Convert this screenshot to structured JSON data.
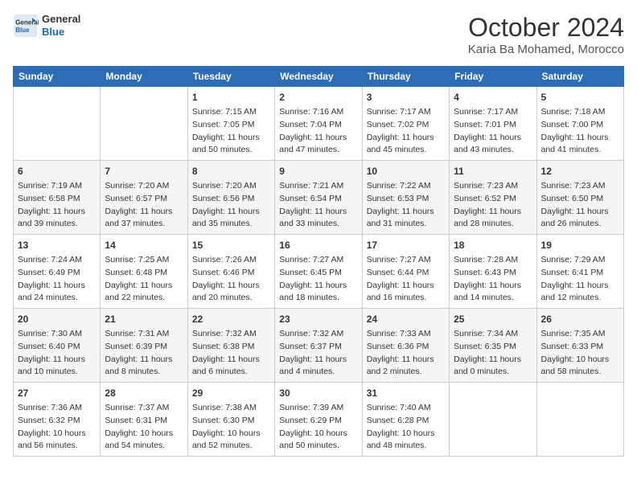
{
  "header": {
    "logo_general": "General",
    "logo_blue": "Blue",
    "month": "October 2024",
    "location": "Karia Ba Mohamed, Morocco"
  },
  "days_of_week": [
    "Sunday",
    "Monday",
    "Tuesday",
    "Wednesday",
    "Thursday",
    "Friday",
    "Saturday"
  ],
  "weeks": [
    [
      {
        "day": "",
        "content": ""
      },
      {
        "day": "",
        "content": ""
      },
      {
        "day": "1",
        "content": "Sunrise: 7:15 AM\nSunset: 7:05 PM\nDaylight: 11 hours and 50 minutes."
      },
      {
        "day": "2",
        "content": "Sunrise: 7:16 AM\nSunset: 7:04 PM\nDaylight: 11 hours and 47 minutes."
      },
      {
        "day": "3",
        "content": "Sunrise: 7:17 AM\nSunset: 7:02 PM\nDaylight: 11 hours and 45 minutes."
      },
      {
        "day": "4",
        "content": "Sunrise: 7:17 AM\nSunset: 7:01 PM\nDaylight: 11 hours and 43 minutes."
      },
      {
        "day": "5",
        "content": "Sunrise: 7:18 AM\nSunset: 7:00 PM\nDaylight: 11 hours and 41 minutes."
      }
    ],
    [
      {
        "day": "6",
        "content": "Sunrise: 7:19 AM\nSunset: 6:58 PM\nDaylight: 11 hours and 39 minutes."
      },
      {
        "day": "7",
        "content": "Sunrise: 7:20 AM\nSunset: 6:57 PM\nDaylight: 11 hours and 37 minutes."
      },
      {
        "day": "8",
        "content": "Sunrise: 7:20 AM\nSunset: 6:56 PM\nDaylight: 11 hours and 35 minutes."
      },
      {
        "day": "9",
        "content": "Sunrise: 7:21 AM\nSunset: 6:54 PM\nDaylight: 11 hours and 33 minutes."
      },
      {
        "day": "10",
        "content": "Sunrise: 7:22 AM\nSunset: 6:53 PM\nDaylight: 11 hours and 31 minutes."
      },
      {
        "day": "11",
        "content": "Sunrise: 7:23 AM\nSunset: 6:52 PM\nDaylight: 11 hours and 28 minutes."
      },
      {
        "day": "12",
        "content": "Sunrise: 7:23 AM\nSunset: 6:50 PM\nDaylight: 11 hours and 26 minutes."
      }
    ],
    [
      {
        "day": "13",
        "content": "Sunrise: 7:24 AM\nSunset: 6:49 PM\nDaylight: 11 hours and 24 minutes."
      },
      {
        "day": "14",
        "content": "Sunrise: 7:25 AM\nSunset: 6:48 PM\nDaylight: 11 hours and 22 minutes."
      },
      {
        "day": "15",
        "content": "Sunrise: 7:26 AM\nSunset: 6:46 PM\nDaylight: 11 hours and 20 minutes."
      },
      {
        "day": "16",
        "content": "Sunrise: 7:27 AM\nSunset: 6:45 PM\nDaylight: 11 hours and 18 minutes."
      },
      {
        "day": "17",
        "content": "Sunrise: 7:27 AM\nSunset: 6:44 PM\nDaylight: 11 hours and 16 minutes."
      },
      {
        "day": "18",
        "content": "Sunrise: 7:28 AM\nSunset: 6:43 PM\nDaylight: 11 hours and 14 minutes."
      },
      {
        "day": "19",
        "content": "Sunrise: 7:29 AM\nSunset: 6:41 PM\nDaylight: 11 hours and 12 minutes."
      }
    ],
    [
      {
        "day": "20",
        "content": "Sunrise: 7:30 AM\nSunset: 6:40 PM\nDaylight: 11 hours and 10 minutes."
      },
      {
        "day": "21",
        "content": "Sunrise: 7:31 AM\nSunset: 6:39 PM\nDaylight: 11 hours and 8 minutes."
      },
      {
        "day": "22",
        "content": "Sunrise: 7:32 AM\nSunset: 6:38 PM\nDaylight: 11 hours and 6 minutes."
      },
      {
        "day": "23",
        "content": "Sunrise: 7:32 AM\nSunset: 6:37 PM\nDaylight: 11 hours and 4 minutes."
      },
      {
        "day": "24",
        "content": "Sunrise: 7:33 AM\nSunset: 6:36 PM\nDaylight: 11 hours and 2 minutes."
      },
      {
        "day": "25",
        "content": "Sunrise: 7:34 AM\nSunset: 6:35 PM\nDaylight: 11 hours and 0 minutes."
      },
      {
        "day": "26",
        "content": "Sunrise: 7:35 AM\nSunset: 6:33 PM\nDaylight: 10 hours and 58 minutes."
      }
    ],
    [
      {
        "day": "27",
        "content": "Sunrise: 7:36 AM\nSunset: 6:32 PM\nDaylight: 10 hours and 56 minutes."
      },
      {
        "day": "28",
        "content": "Sunrise: 7:37 AM\nSunset: 6:31 PM\nDaylight: 10 hours and 54 minutes."
      },
      {
        "day": "29",
        "content": "Sunrise: 7:38 AM\nSunset: 6:30 PM\nDaylight: 10 hours and 52 minutes."
      },
      {
        "day": "30",
        "content": "Sunrise: 7:39 AM\nSunset: 6:29 PM\nDaylight: 10 hours and 50 minutes."
      },
      {
        "day": "31",
        "content": "Sunrise: 7:40 AM\nSunset: 6:28 PM\nDaylight: 10 hours and 48 minutes."
      },
      {
        "day": "",
        "content": ""
      },
      {
        "day": "",
        "content": ""
      }
    ]
  ]
}
